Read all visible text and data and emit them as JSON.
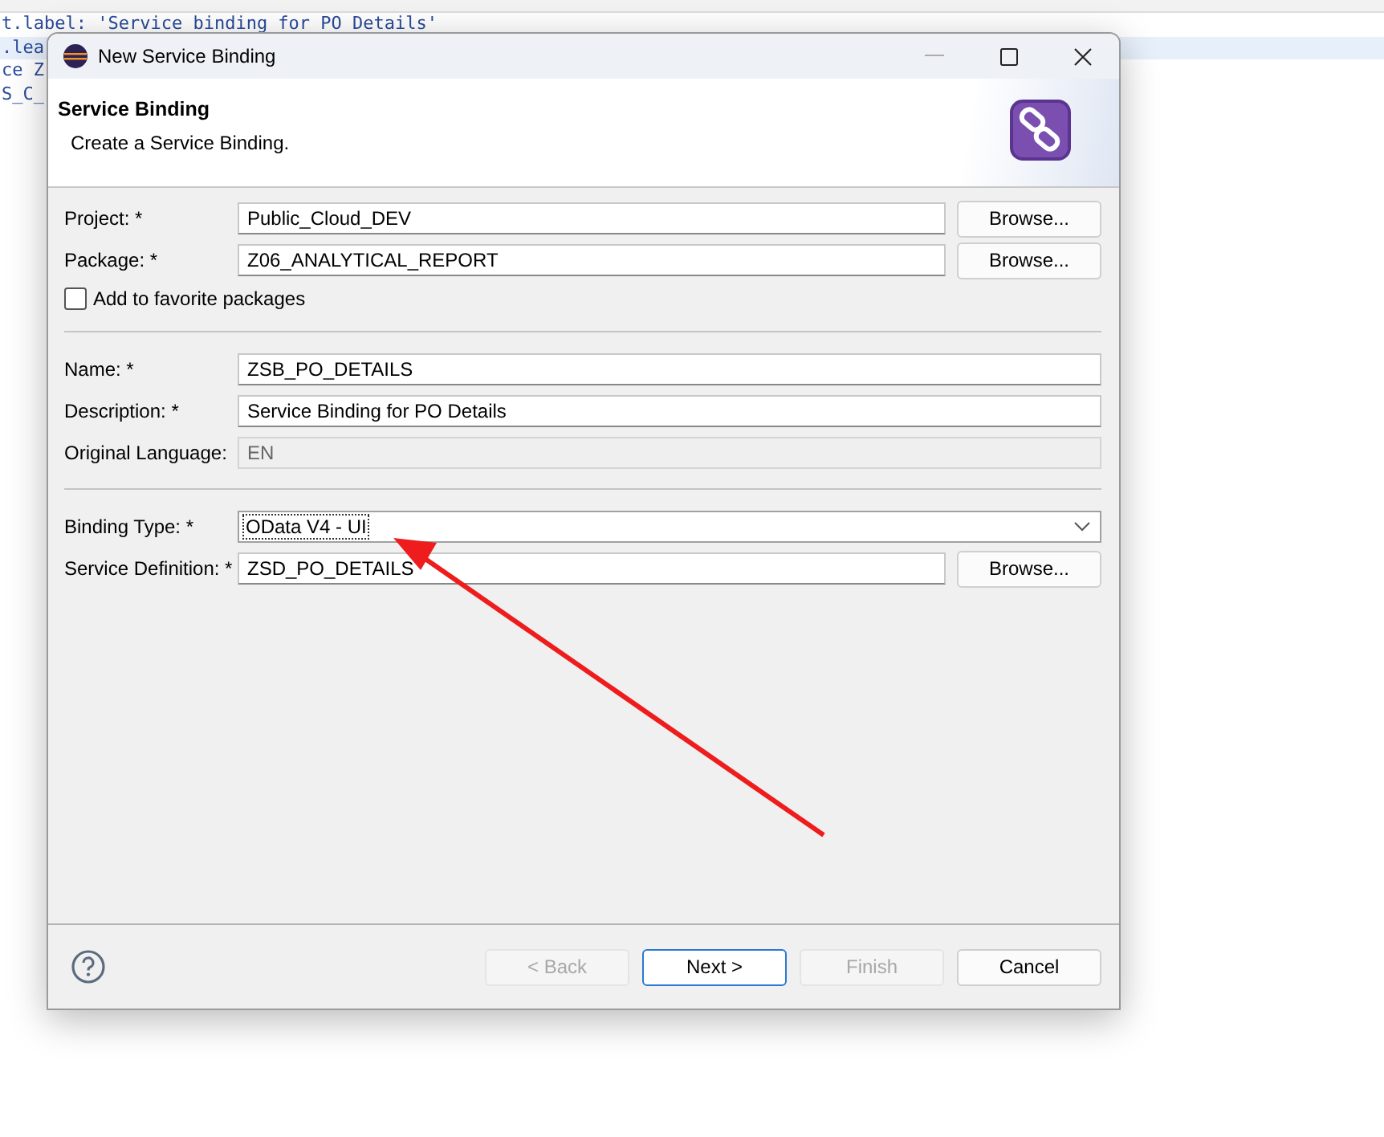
{
  "editor": {
    "code_lines": [
      {
        "text": "t.label: 'Service binding for PO Details'",
        "highlighted": false
      },
      {
        "text": ".lea",
        "highlighted": true
      },
      {
        "text": "ce Z",
        "highlighted": false
      },
      {
        "text": "S_C_",
        "highlighted": false
      }
    ]
  },
  "dialog": {
    "title": "New Service Binding",
    "header": {
      "title": "Service Binding",
      "subtitle": "Create a Service Binding."
    },
    "groups": [
      [
        {
          "label": "Project: *",
          "kind": "text",
          "value": "Public_Cloud_DEV",
          "disabled": false,
          "button": "Browse..."
        },
        {
          "label": "Package: *",
          "kind": "text",
          "value": "Z06_ANALYTICAL_REPORT",
          "disabled": false,
          "button": "Browse..."
        },
        {
          "label": "Add to favorite packages",
          "kind": "checkbox",
          "checked": false
        }
      ],
      [
        {
          "label": "Name: *",
          "kind": "text",
          "value": "ZSB_PO_DETAILS",
          "disabled": false
        },
        {
          "label": "Description: *",
          "kind": "text",
          "value": "Service Binding for PO Details",
          "disabled": false
        },
        {
          "label": "Original Language:",
          "kind": "text",
          "value": "EN",
          "disabled": true
        }
      ],
      [
        {
          "label": "Binding Type: *",
          "kind": "dropdown",
          "value": "OData V4 - UI",
          "disabled": false
        },
        {
          "label": "Service Definition: *",
          "kind": "text",
          "value": "ZSD_PO_DETAILS",
          "disabled": false,
          "button": "Browse..."
        }
      ]
    ],
    "buttons": [
      {
        "label": "< Back",
        "disabled": true,
        "default": false
      },
      {
        "label": "Next >",
        "disabled": false,
        "default": true
      },
      {
        "label": "Finish",
        "disabled": true,
        "default": false
      },
      {
        "label": "Cancel",
        "disabled": false,
        "default": false
      }
    ]
  }
}
